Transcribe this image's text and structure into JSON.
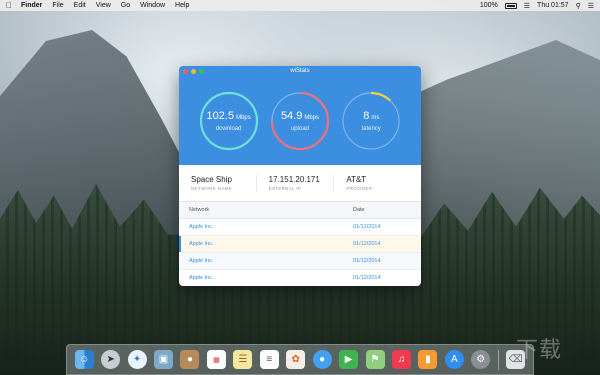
{
  "menubar": {
    "app_name": "Finder",
    "items": [
      "File",
      "Edit",
      "View",
      "Go",
      "Window",
      "Help"
    ],
    "battery": "100%",
    "clock": "Thu 01:57"
  },
  "window": {
    "title": "wiStats",
    "gauges": [
      {
        "value": "102.5",
        "unit": "Mbps",
        "label": "download",
        "color": "#6fe0d8",
        "fill": 1.0
      },
      {
        "value": "54.9",
        "unit": "Mbps",
        "label": "upload",
        "color": "#f2727b",
        "fill": 0.75
      },
      {
        "value": "8",
        "unit": "ms",
        "label": "latency",
        "color": "#f4cf3e",
        "fill": 0.12
      }
    ],
    "info": [
      {
        "value": "Space Ship",
        "key": "NETWORK NAME"
      },
      {
        "value": "17.151.20.171",
        "key": "EXTERNAL IP"
      },
      {
        "value": "AT&T",
        "key": "PROVIDER"
      }
    ],
    "table": {
      "headers": {
        "network": "Network",
        "date": "Date"
      },
      "rows": [
        {
          "network": "Apple Inc.",
          "date": "01/12/2014"
        },
        {
          "network": "Apple Inc.",
          "date": "01/12/2014"
        },
        {
          "network": "Apple Inc.",
          "date": "01/12/2014"
        },
        {
          "network": "Apple Inc.",
          "date": "01/12/2014"
        }
      ]
    }
  },
  "colors": {
    "accent": "#3b8ee0"
  },
  "dock": {
    "icons": [
      "finder-icon",
      "launchpad-icon",
      "safari-icon",
      "preview-icon",
      "contacts-icon",
      "calendar-icon",
      "notes-icon",
      "reminders-icon",
      "photos-icon",
      "messages-icon",
      "facetime-icon",
      "maps-icon",
      "music-icon",
      "books-icon",
      "app-store-icon",
      "system-preferences-icon",
      "trash-icon"
    ]
  },
  "watermark": "下载"
}
